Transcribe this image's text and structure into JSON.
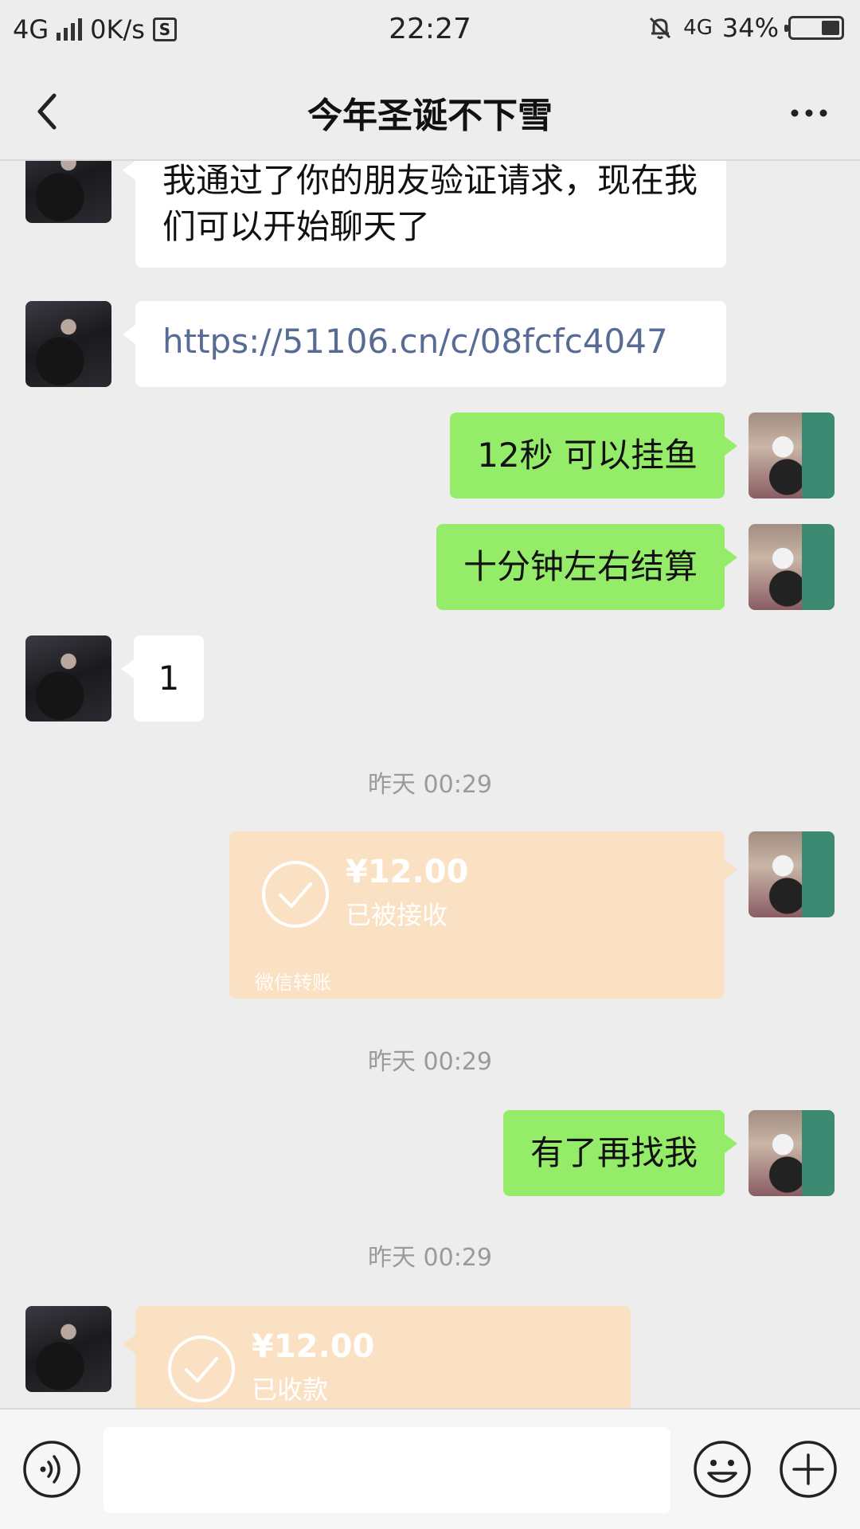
{
  "status_bar": {
    "network": "4G",
    "speed": "0K/s",
    "time": "22:27",
    "network_right": "4G",
    "battery": "34%"
  },
  "header": {
    "title": "今年圣诞不下雪"
  },
  "messages": {
    "m1": "我通过了你的朋友验证请求，现在我们可以开始聊天了",
    "m2": "https://51106.cn/c/08fcfc4047",
    "m3": "12秒 可以挂鱼",
    "m4": "十分钟左右结算",
    "m5": "1",
    "m6": "有了再找我"
  },
  "timestamps": {
    "t1": "昨天 00:29",
    "t2": "昨天 00:29",
    "t3": "昨天 00:29"
  },
  "transfers": {
    "sent": {
      "amount": "¥12.00",
      "status": "已被接收",
      "footer": "微信转账"
    },
    "received": {
      "amount": "¥12.00",
      "status": "已收款"
    }
  },
  "colors": {
    "background": "#ededed",
    "sent_bubble": "#95ec69",
    "received_bubble": "#ffffff",
    "transfer": "#fbe1c4",
    "link": "#576b95"
  },
  "icons": {
    "back": "back-icon",
    "more": "more-icon",
    "voice": "voice-icon",
    "emoji": "emoji-icon",
    "plus": "plus-icon",
    "check": "check-icon"
  }
}
